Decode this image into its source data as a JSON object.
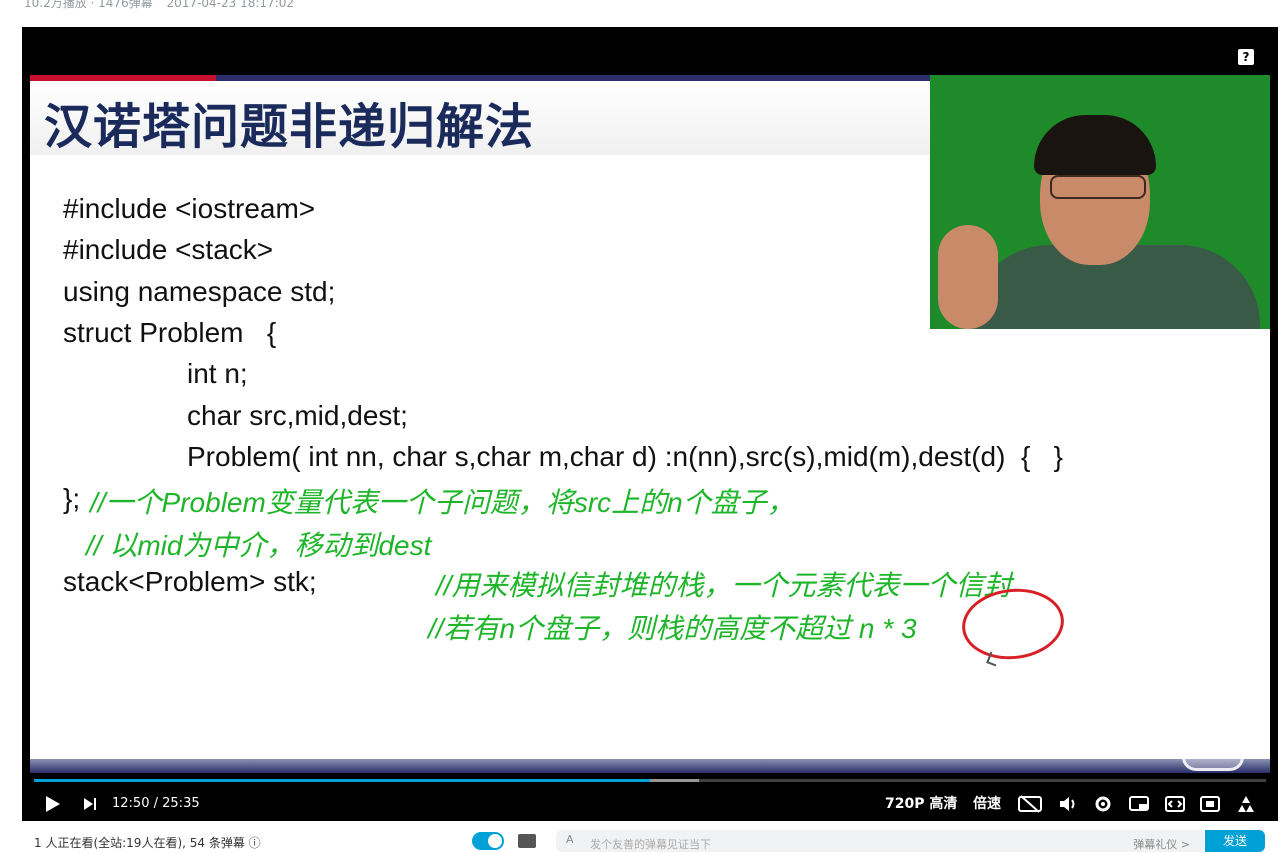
{
  "video_meta": {
    "plays": "10.2万播放 · 1476弹幕",
    "date": "2017-04-23 18:17:02"
  },
  "slide": {
    "title": "汉诺塔问题非递归解法",
    "code": [
      "#include <iostream>",
      "#include <stack>",
      "using namespace std;",
      "struct Problem   {",
      "int n;",
      "char src,mid,dest;",
      "Problem( int nn, char s,char m,char d) :n(nn),src(s),mid(m),dest(d)  {   }",
      "};",
      "stack<Problem> stk;"
    ],
    "comments": [
      "//一个Problem变量代表一个子问题，将src上的n个盘子，",
      "// 以mid为中介，移动到dest",
      "//用来模拟信封堆的栈，一个元素代表一个信封",
      "//若有n个盘子，则栈的高度不超过 n * 3"
    ]
  },
  "player": {
    "help_label": "?",
    "current_time": "12:50",
    "separator": "/",
    "duration": "25:35",
    "played_fraction": 0.5,
    "buffered_fraction": 0.54,
    "quality": "720P 高清",
    "speed": "倍速",
    "logo_text": "▷"
  },
  "below": {
    "viewers": "1 人正在看(全站:19人在看), 54 条弹幕 ⓘ",
    "danmaku_toggle": "弹",
    "input_placeholder": "发个友善的弹幕见证当下",
    "etiquette": "弹幕礼仪 >",
    "send": "发送"
  }
}
